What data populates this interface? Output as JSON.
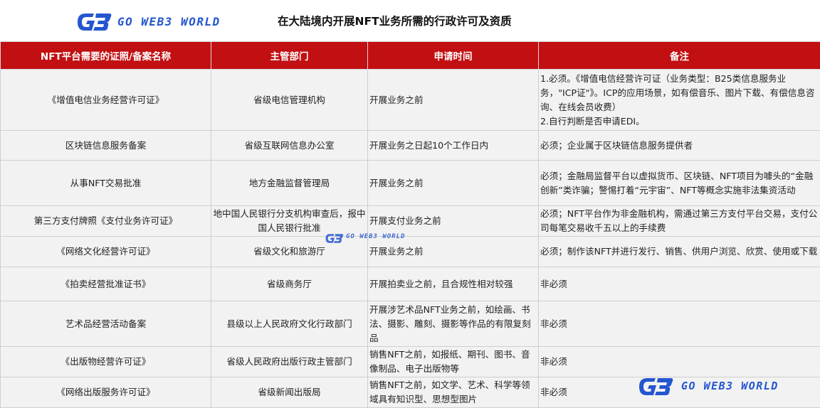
{
  "brand": {
    "logo_text": "GO WEB3 WORLD",
    "logo_icon": "go-web3-logo-icon",
    "accent_color": "#2456d0",
    "header_color": "#c20f12"
  },
  "page": {
    "title": "在大陆境内开展NFT业务所需的行政许可及资质"
  },
  "table": {
    "headers": [
      "NFT平台需要的证照/备案名称",
      "主管部门",
      "申请时间",
      "备注"
    ],
    "rows": [
      {
        "name": "《增值电信业务经营许可证》",
        "department": "省级电信管理机构",
        "time": "开展业务之前",
        "note": "1.必须。《增值电信经营许可证（业务类型：B25类信息服务业务，\"ICP证\"》。ICP的应用场景，如有偿音乐、图片下载、有偿信息咨询、在线会员收费）\n2.自行判断是否申请EDI。"
      },
      {
        "name": "区块链信息服务备案",
        "department": "省级互联网信息办公室",
        "time": "开展业务之日起10个工作日内",
        "note": "必须；企业属于区块链信息服务提供者"
      },
      {
        "name": "从事NFT交易批准",
        "department": "地方金融监督管理局",
        "time": "开展业务之前",
        "note": "必须；金融局监督平台以虚拟货币、区块链、NFT项目为噱头的“金融创新”类诈骗；警惕打着“元宇宙”、NFT等概念实施非法集资活动"
      },
      {
        "name": "第三方支付牌照《支付业务许可证》",
        "department": "地中国人民银行分支机构审查后，报中国人民银行批准",
        "time": "开展支付业务之前",
        "note": "必须；NFT平台作为非金融机构，需通过第三方支付平台交易，支付公司每笔交易收千五以上的手续费"
      },
      {
        "name": "《网络文化经营许可证》",
        "department": "省级文化和旅游厅",
        "time": "开展业务之前",
        "note": "必须；制作该NFT并进行发行、销售、供用户浏览、欣赏、使用或下载"
      },
      {
        "name": "《拍卖经营批准证书》",
        "department": "省级商务厅",
        "time": "开展拍卖业之前，且合规性相对较强",
        "note": "非必须"
      },
      {
        "name": "艺术品经营活动备案",
        "department": "县级以上人民政府文化行政部门",
        "time": "开展涉艺术品NFT业务之前，如绘画、书法、摄影、雕刻、摄影等作品的有限复刻品",
        "note": "非必须"
      },
      {
        "name": "《出版物经营许可证》",
        "department": "省级人民政府出版行政主管部门",
        "time": "销售NFT之前，如报纸、期刊、图书、音像制品、电子出版物等",
        "note": "非必须"
      },
      {
        "name": "《网络出版服务许可证》",
        "department": "省级新闻出版局",
        "time": "销售NFT之前，如文学、艺术、科学等领域具有知识型、思想型图片",
        "note": "非必须"
      }
    ]
  }
}
